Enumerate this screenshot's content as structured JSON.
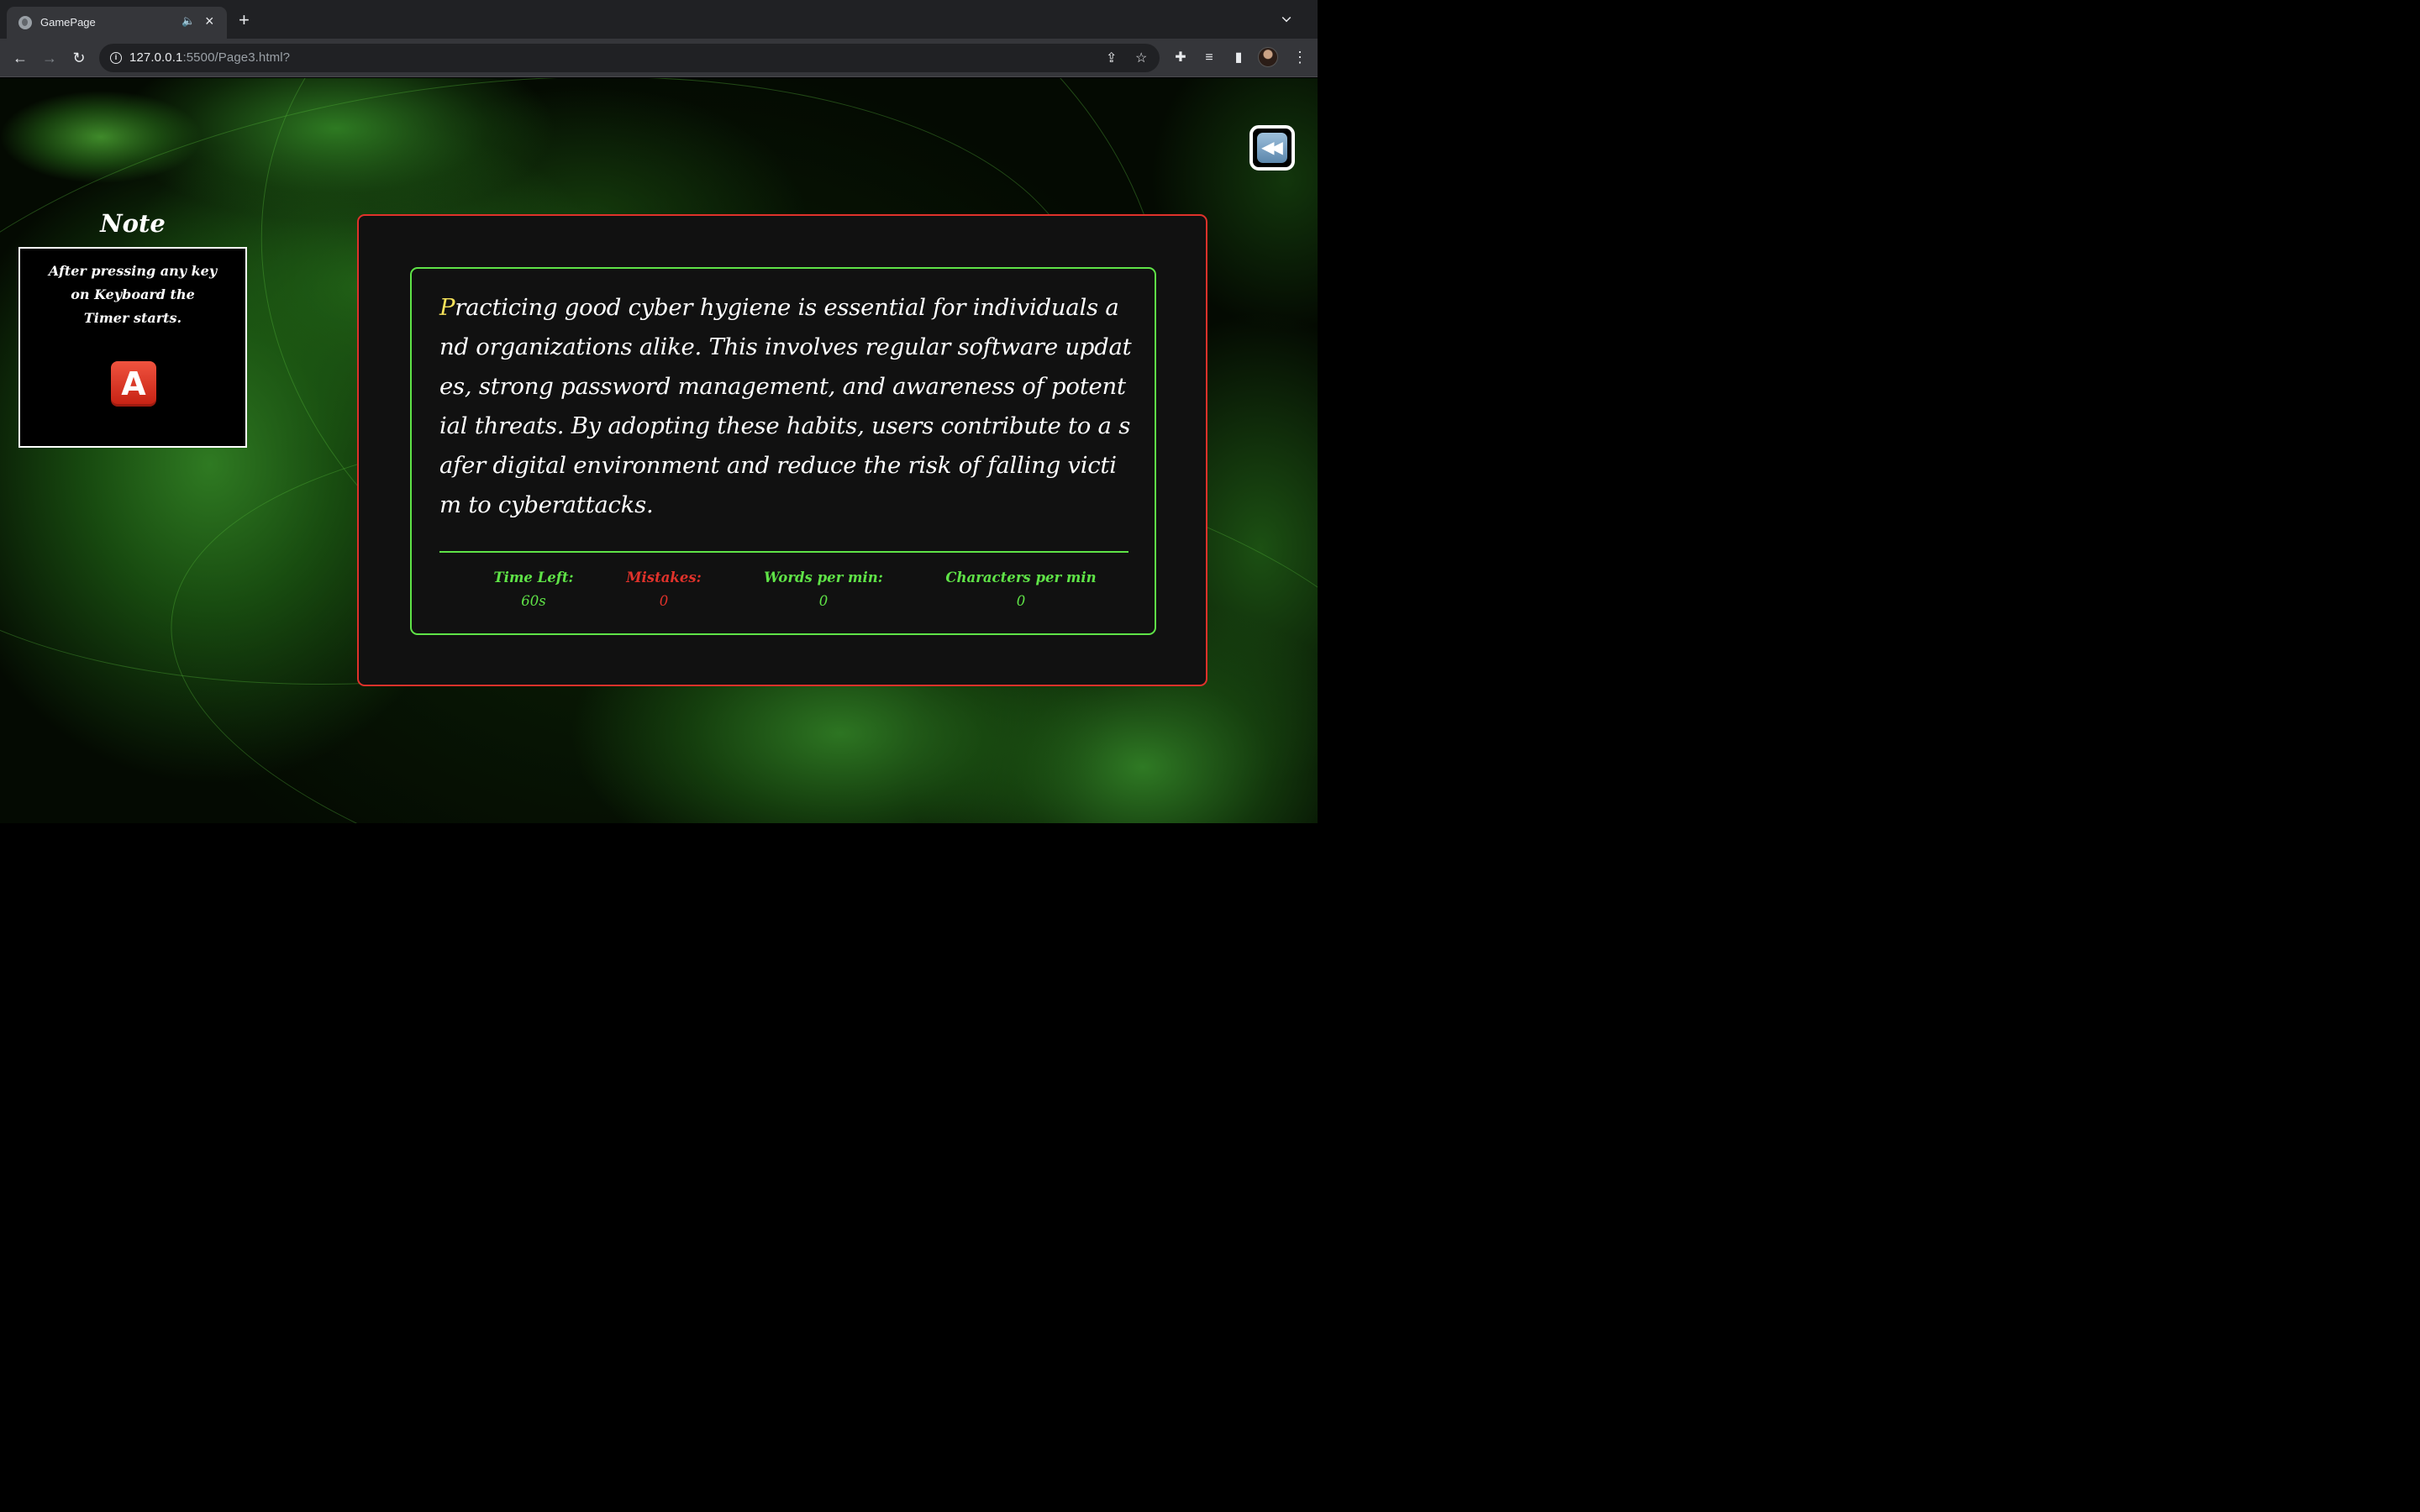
{
  "browser": {
    "tab_title": "GamePage",
    "url_host": "127.0.0.1",
    "url_rest": ":5500/Page3.html?"
  },
  "note": {
    "title": "Note",
    "line1": "After pressing any key",
    "line2": "on Keyboard the",
    "line3": "Timer starts.",
    "key_label": "A"
  },
  "typing": {
    "first_char": "P",
    "rest": "racticing good cyber hygiene is essential for individuals and organizations alike. This involves regular software updates, strong password management, and awareness of potential threats. By adopting these habits, users contribute to a safer digital environment and reduce the risk of falling victim to cyberattacks."
  },
  "stats": {
    "time_label": "Time Left:",
    "time_value": "60s",
    "mistakes_label": "Mistakes:",
    "mistakes_value": "0",
    "wpm_label": "Words per min:",
    "wpm_value": "0",
    "cpm_label": "Characters per min",
    "cpm_value": "0"
  },
  "colors": {
    "outer_border": "#e0322b",
    "inner_border": "#5fe347",
    "cursor_char": "#f5e15a"
  },
  "icons": [
    "globe-favicon-icon",
    "speaker-icon",
    "close-icon",
    "plus-icon",
    "back-arrow-icon",
    "forward-arrow-icon",
    "reload-icon",
    "info-icon",
    "share-icon",
    "star-icon",
    "puzzle-icon",
    "media-icon",
    "sidepanel-icon",
    "menu-icon",
    "rewind-icon",
    "letter-a-key-icon"
  ]
}
